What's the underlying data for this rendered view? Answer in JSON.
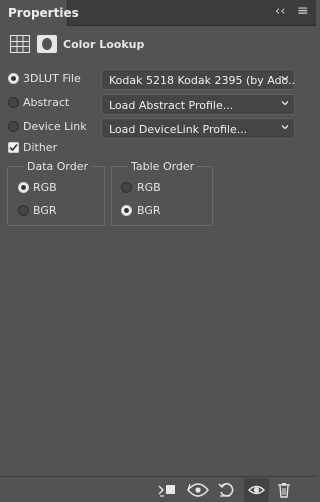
{
  "panel": {
    "tab_label": "Properties",
    "title": "Color Lookup"
  },
  "sources": [
    {
      "label": "3DLUT File",
      "selected": true,
      "dropdown": "Kodak 5218 Kodak 2395 (by Ado..."
    },
    {
      "label": "Abstract",
      "selected": false,
      "dropdown": "Load Abstract Profile..."
    },
    {
      "label": "Device Link",
      "selected": false,
      "dropdown": "Load DeviceLink Profile..."
    }
  ],
  "dither": {
    "label": "Dither",
    "checked": true
  },
  "data_order": {
    "title": "Data Order",
    "options": [
      {
        "label": "RGB",
        "selected": true
      },
      {
        "label": "BGR",
        "selected": false
      }
    ]
  },
  "table_order": {
    "title": "Table Order",
    "options": [
      {
        "label": "RGB",
        "selected": false
      },
      {
        "label": "BGR",
        "selected": true
      }
    ]
  },
  "footer_icons": [
    "clip-to-layer-icon",
    "view-previous-state-icon",
    "reset-icon",
    "visibility-eye-icon",
    "trash-icon"
  ]
}
